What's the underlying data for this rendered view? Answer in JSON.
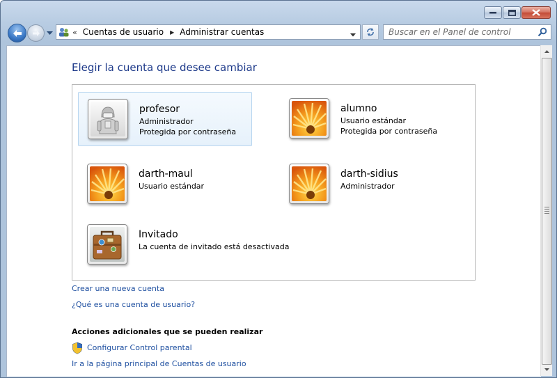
{
  "window": {
    "minimize_icon": "minimize-icon",
    "maximize_icon": "maximize-icon",
    "close_icon": "close-icon"
  },
  "nav": {
    "breadcrumb": [
      "Cuentas de usuario",
      "Administrar cuentas"
    ],
    "overflow_chevron": "«",
    "search_placeholder": "Buscar en el Panel de control"
  },
  "main": {
    "title": "Elegir la cuenta que desee cambiar",
    "accounts": [
      {
        "name": "profesor",
        "lines": [
          "Administrador",
          "Protegida por contraseña"
        ],
        "picture": "robot-picture",
        "selected": true
      },
      {
        "name": "alumno",
        "lines": [
          "Usuario estándar",
          "Protegida por contraseña"
        ],
        "picture": "flower-picture"
      },
      {
        "name": "darth-maul",
        "lines": [
          "Usuario estándar"
        ],
        "picture": "flower-picture"
      },
      {
        "name": "darth-sidius",
        "lines": [
          "Administrador"
        ],
        "picture": "flower-picture"
      },
      {
        "name": "Invitado",
        "lines": [
          "La cuenta de invitado está desactivada"
        ],
        "picture": "suitcase-picture"
      }
    ],
    "links": {
      "create": "Crear una nueva cuenta",
      "what_is": "¿Qué es una cuenta de usuario?"
    },
    "additional": {
      "heading": "Acciones adicionales que se pueden realizar",
      "parental": "Configurar Control parental",
      "home": "Ir a la página principal de Cuentas de usuario"
    }
  },
  "colors": {
    "link": "#1e4fa0",
    "title": "#1e3a8a",
    "selected_bg": "#e6f1fb"
  }
}
